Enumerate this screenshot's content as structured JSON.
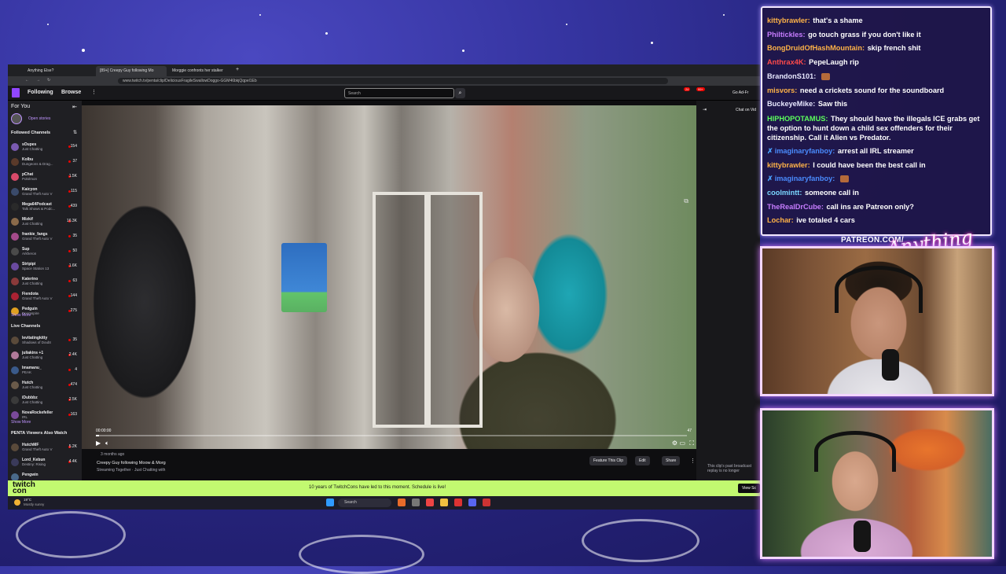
{
  "browser": {
    "tabs": [
      "Anything Else?",
      "[89+] Creepy Guy following Mo",
      "Morggie confronts her stalker"
    ],
    "url": "www.twitch.tv/penta/clip/DeliciousFragileSwallowDoggo-GGM46bkjQqpel1Eb"
  },
  "twitch_nav": {
    "following": "Following",
    "browse": "Browse",
    "search_placeholder": "Search",
    "go_ad_free": "Go Ad-Fr",
    "notif_count": "24",
    "prime_count": "99+"
  },
  "sidebar": {
    "for_you": "For You",
    "open_stories": "Open stories",
    "followed_header": "Followed Channels",
    "followed": [
      {
        "name": "sOupes",
        "game": "Just Chatting",
        "viewers": "154",
        "color": "#7a5ab0"
      },
      {
        "name": "Kolbu",
        "game": "Dungeons & Drag...",
        "viewers": "37",
        "color": "#5a3a2a"
      },
      {
        "name": "pChat",
        "game": "Pokémon",
        "viewers": "1.5K",
        "color": "#d84a6a"
      },
      {
        "name": "Kaicyon",
        "game": "Grand Theft Auto V",
        "viewers": "115",
        "color": "#3a4a6a"
      },
      {
        "name": "Mega64Podcast",
        "game": "Talk Shows & Podc...",
        "viewers": "439",
        "color": "#2a2a2a"
      },
      {
        "name": "Mizkif",
        "game": "Just Chatting",
        "viewers": "16.3K",
        "color": "#8a6a4a"
      },
      {
        "name": "frankie_fangs",
        "game": "Grand Theft Auto V",
        "viewers": "35",
        "color": "#a44a8a"
      },
      {
        "name": "Sup",
        "game": "Arkheron",
        "viewers": "50",
        "color": "#4a4a4a"
      },
      {
        "name": "Stripipi",
        "game": "Space Station 13",
        "viewers": "1.6K",
        "color": "#6a4aa0"
      },
      {
        "name": "Katerino",
        "game": "Just Chatting",
        "viewers": "63",
        "color": "#8a3a3a"
      },
      {
        "name": "Fiendota",
        "game": "Grand Theft Auto V",
        "viewers": "144",
        "color": "#aa2233"
      },
      {
        "name": "Pedguin",
        "game": "Doomspire",
        "viewers": "275",
        "color": "#e0a020"
      }
    ],
    "show_more": "Show More",
    "live_header": "Live Channels",
    "live": [
      {
        "name": "levitatingkitty",
        "game": "Shadows of Doubt",
        "viewers": "35",
        "color": "#5a4a3a"
      },
      {
        "name": "juliakins +1",
        "game": "Just Chatting",
        "viewers": "2.4K",
        "color": "#b07a9a"
      },
      {
        "name": "Imamanu_",
        "game": "PEAK",
        "viewers": "4",
        "color": "#3a5a8a"
      },
      {
        "name": "Hutch",
        "game": "Just Chatting",
        "viewers": "474",
        "color": "#6a5a4a"
      },
      {
        "name": "iDubbbz",
        "game": "Just Chatting",
        "viewers": "2.5K",
        "color": "#3a3a3a"
      },
      {
        "name": "NovaRockefeller",
        "game": "IRL",
        "viewers": "163",
        "color": "#7a4a9a"
      }
    ],
    "show_more_2": "Show More",
    "also_header": "PENTA Viewers Also Watch",
    "also": [
      {
        "name": "HutchMF",
        "game": "Grand Theft Auto V",
        "viewers": "5.2K",
        "color": "#5a4a3a"
      },
      {
        "name": "Lord_Kebun",
        "game": "Destiny: Rising",
        "viewers": "4.4K",
        "color": "#3a3a5a"
      },
      {
        "name": "Pengwin",
        "game": "",
        "viewers": "",
        "color": "#4a6a8a"
      }
    ]
  },
  "player": {
    "time_current": "00:00:00",
    "time_total": "47",
    "progress": 0.005
  },
  "clip": {
    "age": "3 months ago",
    "title": "Creepy Guy following Moow & Morg",
    "meta": "Streaming Together · Just Chatting with",
    "feature_btn": "Feature This Clip",
    "edit_btn": "Edit",
    "share_btn": "Share"
  },
  "chat_column": {
    "header": "Chat on Vid",
    "notice": "This clip's past broadcast replay is no longer"
  },
  "banner": {
    "logo_line1": "twitch",
    "logo_line2": "con",
    "text": "10 years of TwitchCons have led to this moment. Schedule is live!",
    "button": "View Sc"
  },
  "taskbar": {
    "weather_temp": "19°C",
    "weather_desc": "Mostly sunny",
    "search": "Search"
  },
  "chat_overlay": {
    "messages": [
      {
        "user": "kittybrawler:",
        "text": "that's a shame",
        "color": "#ffb347"
      },
      {
        "user": "Philtickles:",
        "text": "go touch grass if you don't like it",
        "color": "#c77dff"
      },
      {
        "user": "BongDruidOfHashMountain:",
        "text": "skip french shit",
        "color": "#ffb347"
      },
      {
        "user": "Anthrax4K:",
        "text": "PepeLaugh rip",
        "color": "#ff4a4a"
      },
      {
        "user": "BrandonS101:",
        "text": "",
        "color": "#e8e8ff"
      },
      {
        "user": "misvors:",
        "text": "need a crickets sound for the soundboard",
        "color": "#ffb347"
      },
      {
        "user": "BuckeyeMike:",
        "text": "Saw this",
        "color": "#e8e8ff"
      },
      {
        "user": "HIPHOPOTAMUS:",
        "text": "They should have the illegals ICE grabs get the option to hunt down a child sex offenders for their citizenship. Call it Alien vs Predator.",
        "color": "#5cff5c"
      },
      {
        "user": "imaginaryfanboy:",
        "text": "arrest all IRL streamer",
        "color": "#4a8cff"
      },
      {
        "user": "kittybrawler:",
        "text": "I could have been the best call in",
        "color": "#ffb347"
      },
      {
        "user": "imaginaryfanboy:",
        "text": "",
        "color": "#4a8cff"
      },
      {
        "user": "coolmintt:",
        "text": "someone call in",
        "color": "#7ad7ff"
      },
      {
        "user": "TheRealDrCube:",
        "text": "call ins are Patreon only?",
        "color": "#c77dff"
      },
      {
        "user": "Lochar:",
        "text": "ive totaled 4 cars",
        "color": "#ffb347"
      }
    ]
  },
  "overlay": {
    "patreon": "PATREON.COM/",
    "logo": "Anything Else?"
  }
}
